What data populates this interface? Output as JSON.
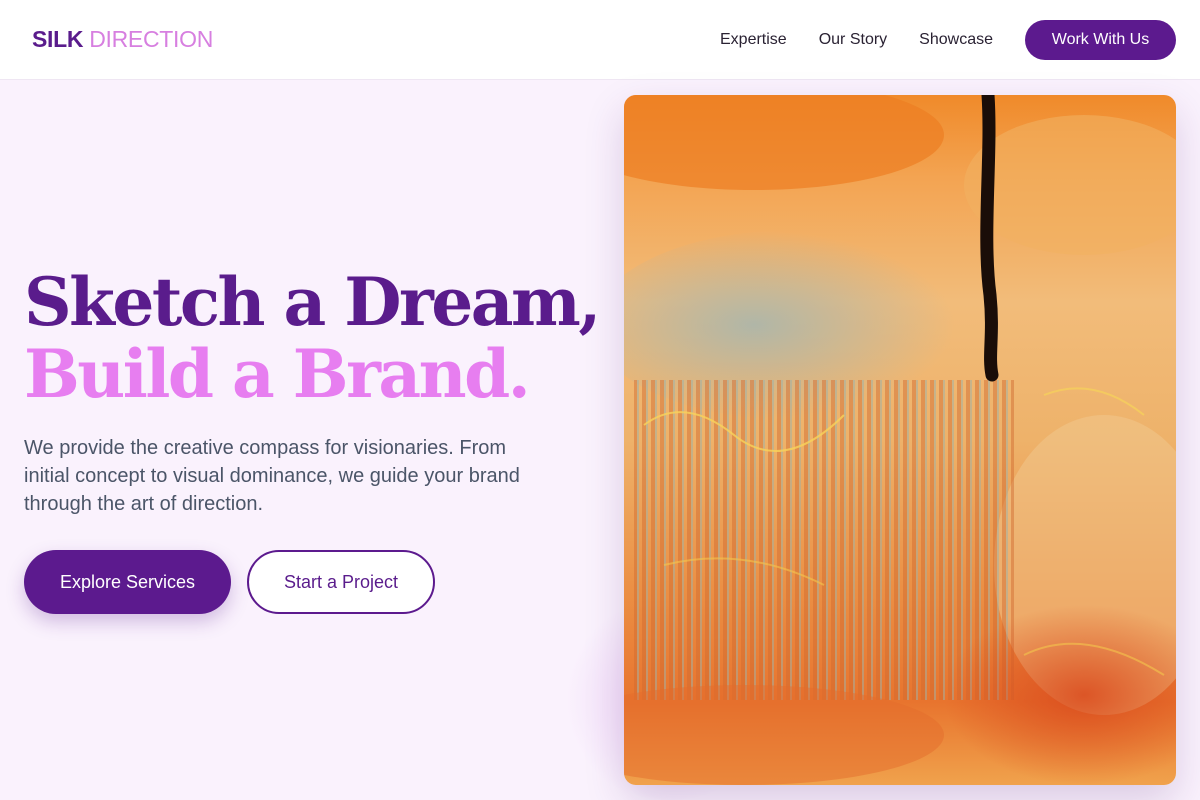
{
  "brand": {
    "primary": "SILK",
    "secondary": "DIRECTION"
  },
  "nav": {
    "links": [
      "Expertise",
      "Our Story",
      "Showcase"
    ],
    "cta": "Work With Us"
  },
  "hero": {
    "title_line1": "Sketch a Dream,",
    "title_line2": "Build a Brand.",
    "description": "We provide the creative compass for visionaries. From initial concept to visual dominance, we guide your brand through the art of direction.",
    "primary_button": "Explore Services",
    "secondary_button": "Start a Project"
  },
  "colors": {
    "brand_purple": "#5c1a8e",
    "accent_pink": "#e77ef0",
    "background": "#faf2fd"
  }
}
